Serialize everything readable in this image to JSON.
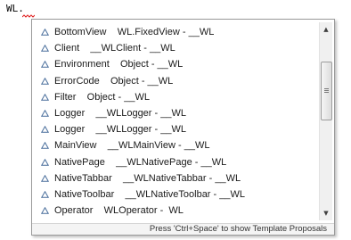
{
  "editor": {
    "typed_text": "WL."
  },
  "proposals": [
    {
      "label": "BottomView    WL.FixedView - __WL"
    },
    {
      "label": "Client    __WLClient - __WL"
    },
    {
      "label": "Environment    Object - __WL"
    },
    {
      "label": "ErrorCode    Object - __WL"
    },
    {
      "label": "Filter    Object - __WL"
    },
    {
      "label": "Logger    __WLLogger - __WL"
    },
    {
      "label": "Logger    __WLLogger - __WL"
    },
    {
      "label": "MainView    __WLMainView - __WL"
    },
    {
      "label": "NativePage    __WLNativePage - __WL"
    },
    {
      "label": "NativeTabbar    __WLNativeTabbar - __WL"
    },
    {
      "label": "NativeToolbar    __WLNativeToolbar - __WL"
    },
    {
      "label": "Operator    WLOperator -  WL"
    }
  ],
  "item_icon": "class-triangle-icon",
  "scrollbar": {
    "up_icon": "scroll-up-arrow-icon",
    "down_icon": "scroll-down-arrow-icon",
    "up_glyph": "▲",
    "down_glyph": "▼"
  },
  "footer": {
    "hint": "Press 'Ctrl+Space' to show Template Proposals"
  },
  "colors": {
    "error_squiggle": "#e02020",
    "icon_outline": "#4a6f9c"
  }
}
